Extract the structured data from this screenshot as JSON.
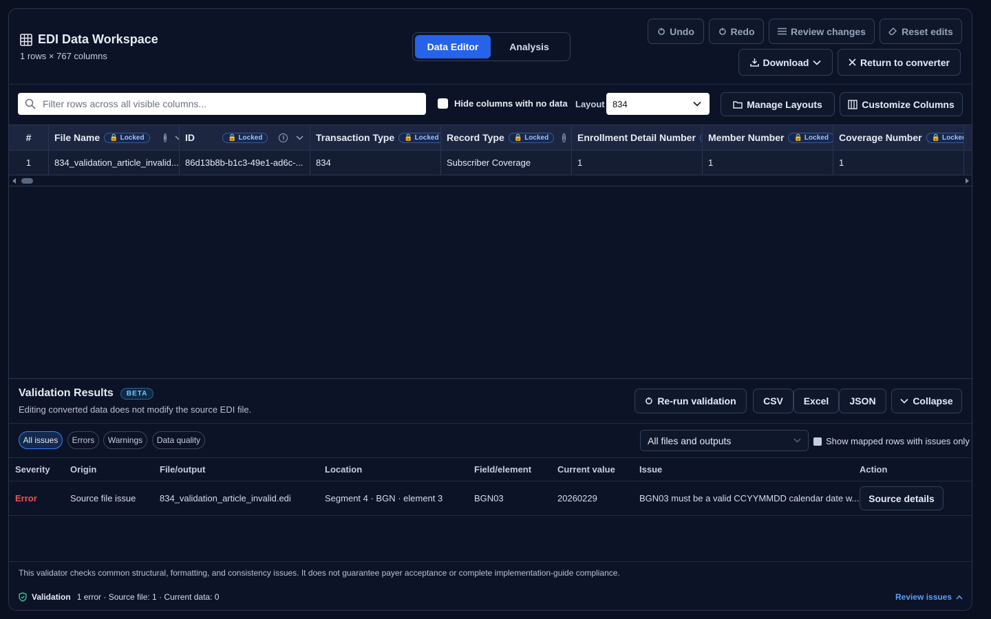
{
  "header": {
    "title": "EDI Data Workspace",
    "subtitle": "1 rows × 767 columns",
    "tabs": {
      "data_editor": "Data Editor",
      "analysis": "Analysis"
    },
    "undo": "Undo",
    "redo": "Redo",
    "review_changes": "Review changes",
    "reset_edits": "Reset edits",
    "download": "Download",
    "return": "Return to converter"
  },
  "toolbar": {
    "filter_placeholder": "Filter rows across all visible columns...",
    "hide_empty_label": "Hide columns with no data",
    "layout_label": "Layout",
    "layout_value": "834",
    "manage_layouts": "Manage Layouts",
    "customize_columns": "Customize Columns"
  },
  "grid": {
    "row_num_header": "#",
    "locked_label": "Locked",
    "columns": [
      {
        "name": "File Name",
        "value": "834_validation_article_invalid..."
      },
      {
        "name": "ID",
        "value": "86d13b8b-b1c3-49e1-ad6c-..."
      },
      {
        "name": "Transaction Type",
        "value": "834"
      },
      {
        "name": "Record Type",
        "value": "Subscriber Coverage"
      },
      {
        "name": "Enrollment Detail Number",
        "value": "1"
      },
      {
        "name": "Member Number",
        "value": "1"
      },
      {
        "name": "Coverage Number",
        "value": "1"
      }
    ],
    "row_number": "1"
  },
  "validation": {
    "title": "Validation Results",
    "badge": "BETA",
    "subtitle": "Editing converted data does not modify the source EDI file.",
    "rerun": "Re-run validation",
    "csv": "CSV",
    "excel": "Excel",
    "json": "JSON",
    "collapse": "Collapse",
    "filters": [
      "All issues",
      "Errors",
      "Warnings",
      "Data quality"
    ],
    "files_select": "All files and outputs",
    "show_mapped_label": "Show mapped rows with issues only",
    "headers": [
      "Severity",
      "Origin",
      "File/output",
      "Location",
      "Field/element",
      "Current value",
      "Issue",
      "Action"
    ],
    "row": {
      "severity": "Error",
      "origin": "Source file issue",
      "file": "834_validation_article_invalid.edi",
      "location": "Segment 4 · BGN · element 3",
      "field": "BGN03",
      "value": "20260229",
      "issue": "BGN03 must be a valid CCYYMMDD calendar date w...",
      "action": "Source details"
    },
    "disclaimer": "This validator checks common structural, formatting, and consistency issues. It does not guarantee payer acceptance or complete implementation-guide compliance.",
    "status_label": "Validation",
    "status_text": "1 error · Source file: 1 · Current data: 0",
    "review_issues": "Review issues"
  },
  "colors": {
    "accent": "#2563eb",
    "error": "#f05252",
    "link": "#5aa0ff"
  }
}
